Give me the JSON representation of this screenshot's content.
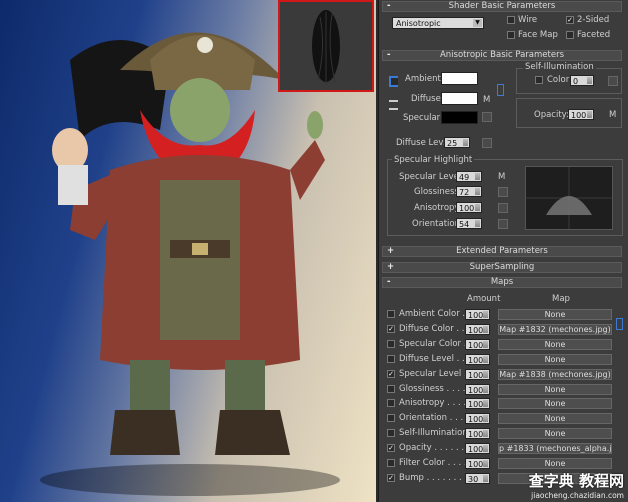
{
  "rollouts": {
    "shader_basic": "Shader Basic Parameters",
    "aniso_basic": "Anisotropic Basic Parameters",
    "extended": "Extended Parameters",
    "supersampling": "SuperSampling",
    "maps": "Maps"
  },
  "rollout_signs": {
    "shader_basic": "-",
    "aniso_basic": "-",
    "extended": "+",
    "supersampling": "+",
    "maps": "-"
  },
  "shader": {
    "selected": "Anisotropic",
    "wire": "Wire",
    "wire_checked": false,
    "two_sided": "2-Sided",
    "two_sided_checked": true,
    "face_map": "Face Map",
    "face_map_checked": false,
    "faceted": "Faceted",
    "faceted_checked": false
  },
  "basic": {
    "ambient": "Ambient:",
    "diffuse": "Diffuse:",
    "specular": "Specular:",
    "ambient_color": "#ffffff",
    "diffuse_color": "#ffffff",
    "specular_color": "#000000",
    "m": "M",
    "self_illum": "Self-Illumination",
    "color": "Color",
    "color_value": "0",
    "opacity": "Opacity:",
    "opacity_value": "100",
    "diffuse_lev": "Diffuse Lev:",
    "diffuse_lev_value": "25"
  },
  "highlight": {
    "title": "Specular Highlight",
    "specular_level": "Specular Level:",
    "specular_level_value": "49",
    "glossiness": "Glossiness:",
    "glossiness_value": "72",
    "anisotropy": "Anisotropy:",
    "anisotropy_value": "100",
    "orientation": "Orientation:",
    "orientation_value": "54"
  },
  "maps": {
    "amount_header": "Amount",
    "map_header": "Map",
    "rows": [
      {
        "label": "Ambient Color . .",
        "checked": false,
        "amount": "100",
        "map": "None"
      },
      {
        "label": "Diffuse Color . . .",
        "checked": true,
        "amount": "100",
        "map": "Map #1832 (mechones.jpg)"
      },
      {
        "label": "Specular Color . .",
        "checked": false,
        "amount": "100",
        "map": "None"
      },
      {
        "label": "Diffuse Level . . .",
        "checked": false,
        "amount": "100",
        "map": "None"
      },
      {
        "label": "Specular Level . .",
        "checked": true,
        "amount": "100",
        "map": "Map #1838 (mechones.jpg)"
      },
      {
        "label": "Glossiness . . . . .",
        "checked": false,
        "amount": "100",
        "map": "None"
      },
      {
        "label": "Anisotropy . . . . .",
        "checked": false,
        "amount": "100",
        "map": "None"
      },
      {
        "label": "Orientation . . . . .",
        "checked": false,
        "amount": "100",
        "map": "None"
      },
      {
        "label": "Self-Illumination . .",
        "checked": false,
        "amount": "100",
        "map": "None"
      },
      {
        "label": "Opacity . . . . . . .",
        "checked": true,
        "amount": "100",
        "map": "p #1833 (mechones_alpha.jpg)"
      },
      {
        "label": "Filter Color . . . .",
        "checked": false,
        "amount": "100",
        "map": "None"
      },
      {
        "label": "Bump . . . . . . . .",
        "checked": true,
        "amount": "30",
        "map": ""
      }
    ]
  },
  "watermark": {
    "big": "查字典 教程网",
    "small": "jiaocheng.chazidian.com"
  },
  "colors": {
    "panel": "#3c3c3c",
    "preview_border": "#d01818",
    "accent_blue": "#3a7bd5"
  }
}
